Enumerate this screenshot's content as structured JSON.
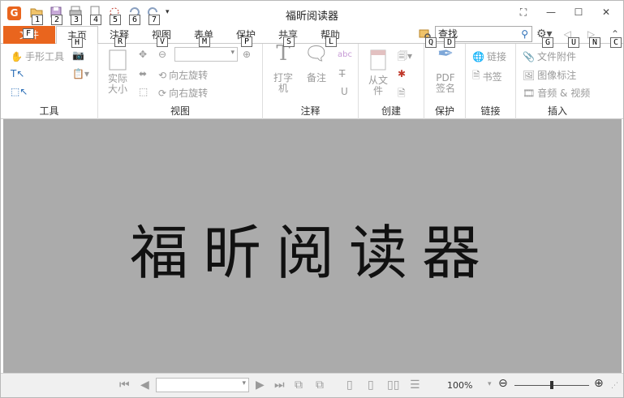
{
  "window": {
    "title": "福昕阅读器"
  },
  "qat": {
    "keytips": [
      "1",
      "2",
      "3",
      "4",
      "5",
      "6",
      "7"
    ]
  },
  "tabs": {
    "file": {
      "label": "文件",
      "keytip": "F"
    },
    "items": [
      {
        "label": "主页",
        "keytip": "H",
        "active": true
      },
      {
        "label": "注释",
        "keytip": "R"
      },
      {
        "label": "视图",
        "keytip": "V"
      },
      {
        "label": "表单",
        "keytip": "M"
      },
      {
        "label": "保护",
        "keytip": "P"
      },
      {
        "label": "共享",
        "keytip": "S"
      },
      {
        "label": "帮助",
        "keytip": "L"
      }
    ],
    "search_keytip": "Q",
    "search_placeholder": "查找",
    "right_keytips": [
      "D",
      "G",
      "U",
      "N",
      "C"
    ]
  },
  "ribbon": {
    "tools": {
      "label": "工具",
      "hand": "手形工具"
    },
    "view": {
      "label": "视图",
      "actual_size": "实际大小",
      "rotate_left": "向左旋转",
      "rotate_right": "向右旋转"
    },
    "annotate": {
      "label": "注释",
      "typewriter": "打字机",
      "note": "备注"
    },
    "create": {
      "label": "创建",
      "from_file": "从文件"
    },
    "protect": {
      "label": "保护",
      "pdf_sign": "PDF签名"
    },
    "links": {
      "label": "链接",
      "link": "链接",
      "bookmark": "书签"
    },
    "insert": {
      "label": "插入",
      "attachment": "文件附件",
      "image": "图像标注",
      "audio_video": "音频 & 视频"
    }
  },
  "document": {
    "splash_text": "福昕阅读器"
  },
  "statusbar": {
    "zoom": "100%"
  }
}
